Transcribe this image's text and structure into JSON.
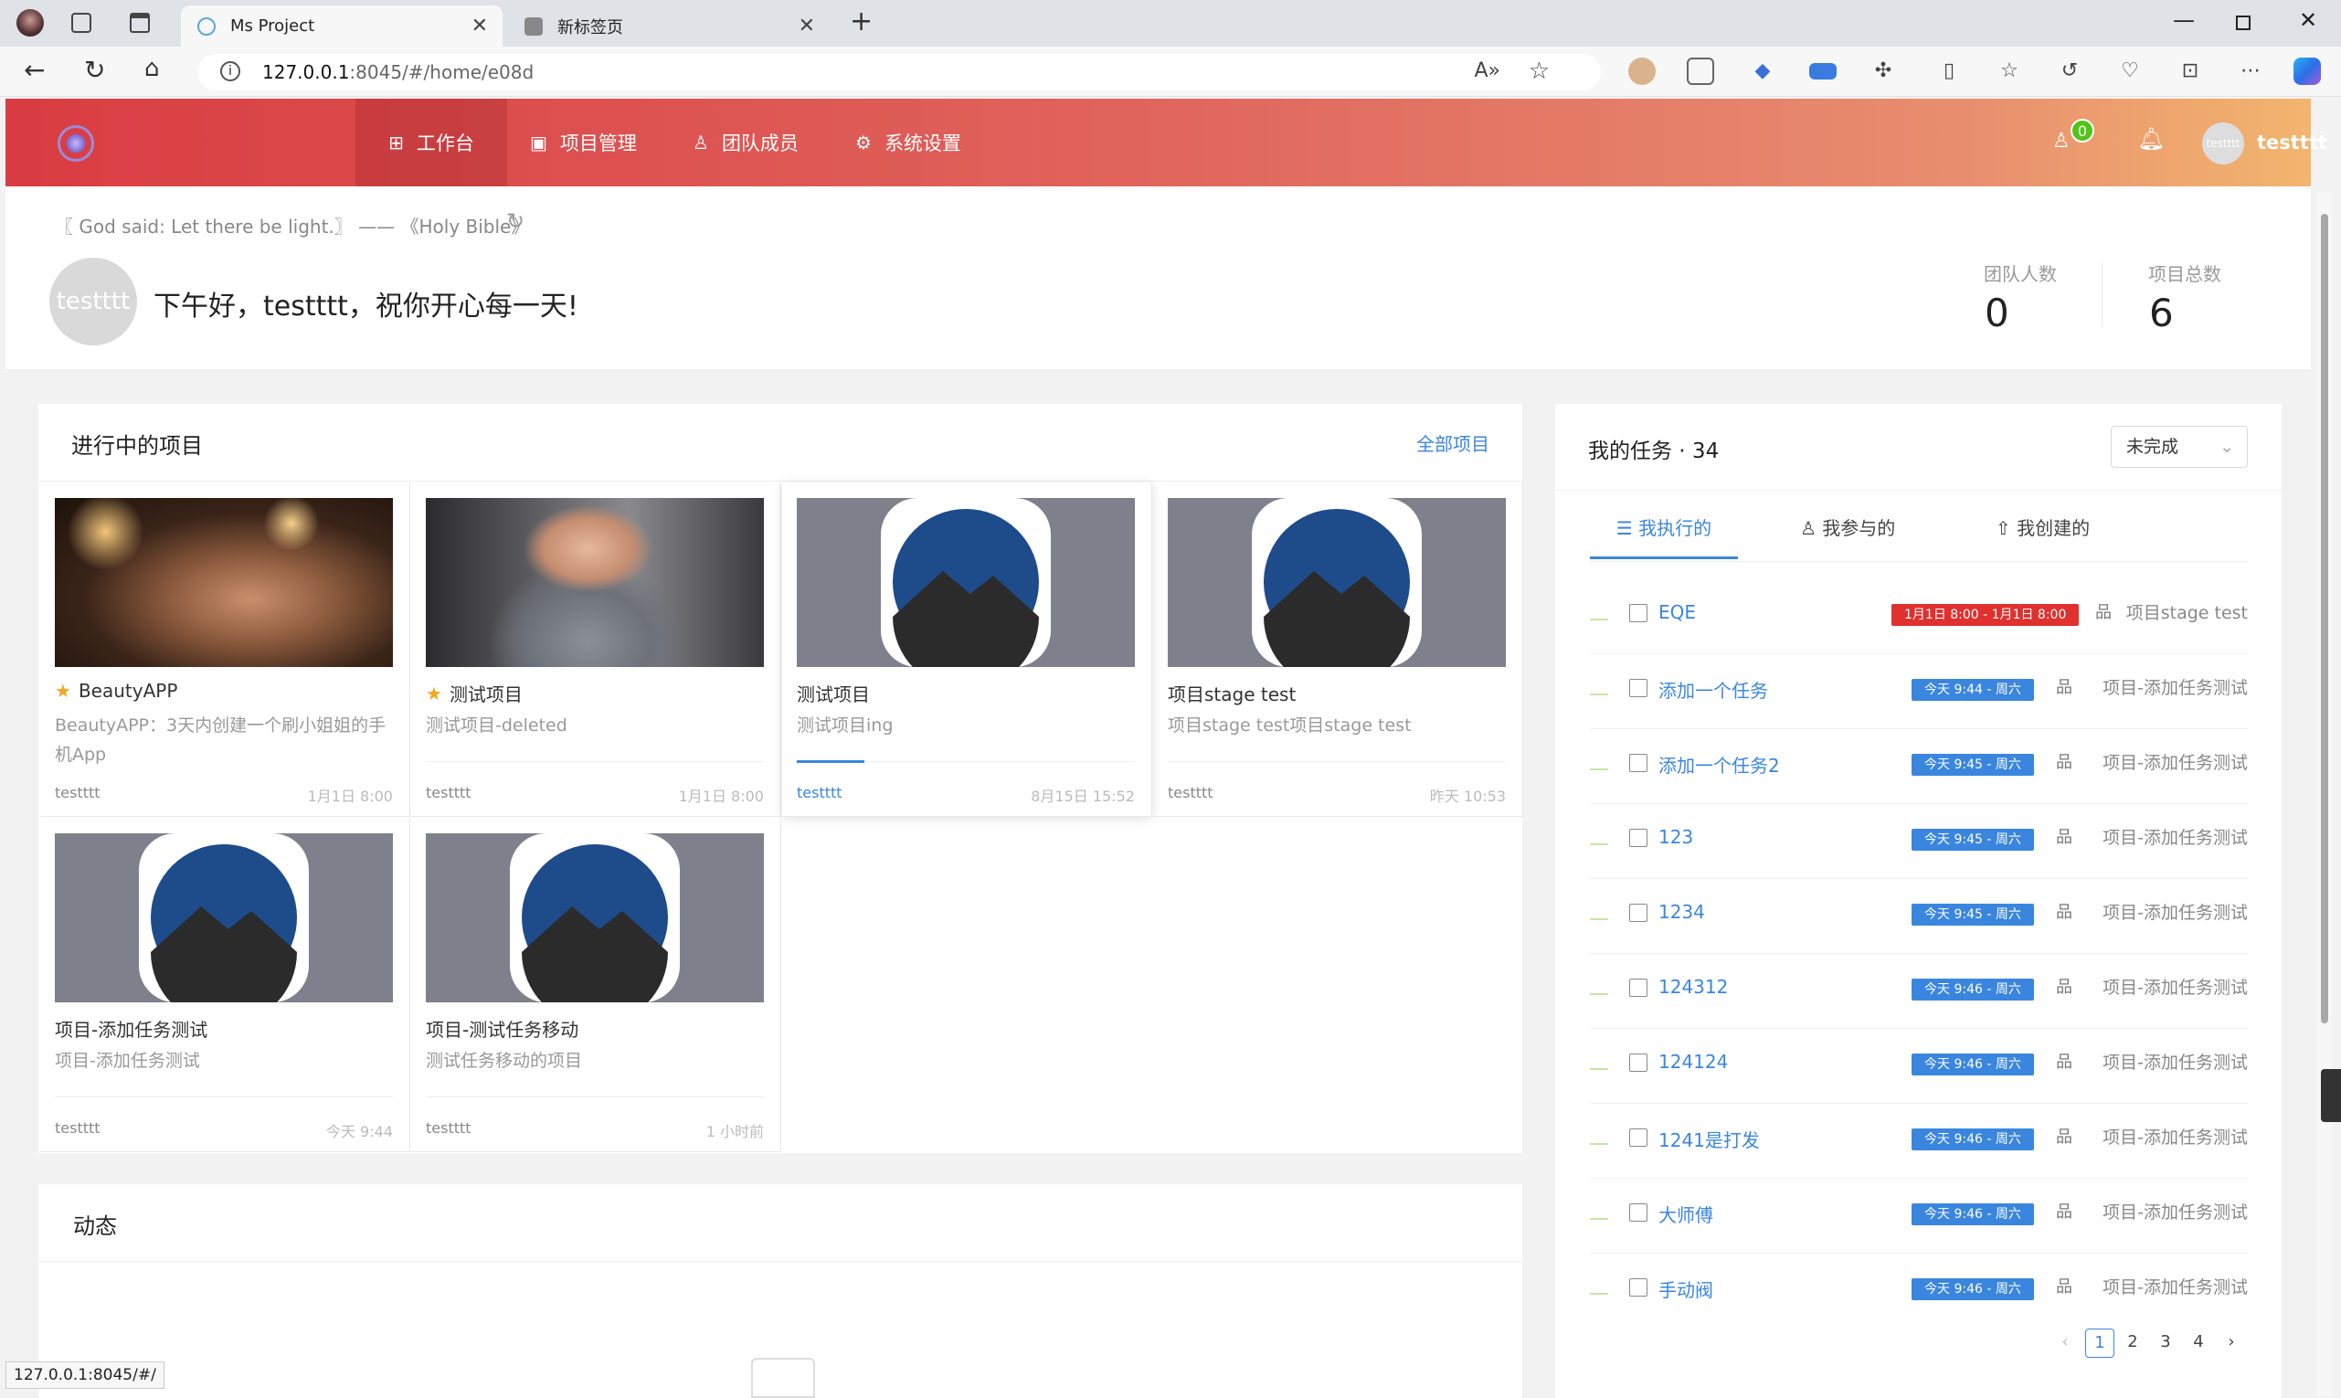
{
  "browser": {
    "tabs": [
      {
        "title": "Ms Project",
        "active": true
      },
      {
        "title": "新标签页",
        "active": false
      }
    ],
    "url_host": "127.0.0.1",
    "url_rest": ":8045/#/home/e08d",
    "status_url": "127.0.0.1:8045/#/"
  },
  "header": {
    "nav": [
      {
        "label": "工作台",
        "icon": "dashboard-icon",
        "active": true
      },
      {
        "label": "项目管理",
        "icon": "project-icon",
        "active": false
      },
      {
        "label": "团队成员",
        "icon": "team-icon",
        "active": false
      },
      {
        "label": "系统设置",
        "icon": "settings-icon",
        "active": false
      }
    ],
    "invite_count": "0",
    "user_name": "testttt",
    "avatar_text": "testttt"
  },
  "greeting": {
    "quote": "〖 God said: Let there be light.〗 —— 《Holy Bible》",
    "avatar_text": "testttt",
    "message": "下午好，testttt，祝你开心每一天!",
    "stats": [
      {
        "label": "团队人数",
        "value": "0"
      },
      {
        "label": "项目总数",
        "value": "6"
      }
    ]
  },
  "projects": {
    "title": "进行中的项目",
    "all_link": "全部项目",
    "items": [
      {
        "name": "BeautyAPP",
        "starred": true,
        "desc": "BeautyAPP：3天内创建一个刷小姐姐的手机App",
        "owner": "testttt",
        "time": "1月1日 8:00",
        "image": "woman-bar-photo"
      },
      {
        "name": "测试项目",
        "starred": true,
        "desc": "测试项目-deleted",
        "owner": "testttt",
        "time": "1月1日 8:00",
        "image": "woman-gym-photo"
      },
      {
        "name": "测试项目",
        "starred": false,
        "desc": "测试项目ing",
        "owner": "testttt",
        "time": "8月15日 15:52",
        "image": "default-project-icon",
        "progress": 0.2
      },
      {
        "name": "项目stage test",
        "starred": false,
        "desc": "项目stage test项目stage test",
        "owner": "testttt",
        "time": "昨天 10:53",
        "image": "default-project-icon"
      },
      {
        "name": "项目-添加任务测试",
        "starred": false,
        "desc": "项目-添加任务测试",
        "owner": "testttt",
        "time": "今天 9:44",
        "image": "default-project-icon"
      },
      {
        "name": "项目-测试任务移动",
        "starred": false,
        "desc": "测试任务移动的项目",
        "owner": "testttt",
        "time": "1 小时前",
        "image": "default-project-icon"
      }
    ]
  },
  "activity": {
    "title": "动态"
  },
  "tasks": {
    "title": "我的任务 · 34",
    "filter": "未完成",
    "tabs": [
      {
        "label": "我执行的",
        "icon": "list-icon",
        "active": true
      },
      {
        "label": "我参与的",
        "icon": "user-icon",
        "active": false
      },
      {
        "label": "我创建的",
        "icon": "rocket-icon",
        "active": false
      }
    ],
    "items": [
      {
        "name": "EQE",
        "due": "1月1日 8:00 - 1月1日 8:00",
        "overdue": true,
        "project": "项目stage test"
      },
      {
        "name": "添加一个任务",
        "due": "今天 9:44 - 周六",
        "overdue": false,
        "project": "项目-添加任务测试"
      },
      {
        "name": "添加一个任务2",
        "due": "今天 9:45 - 周六",
        "overdue": false,
        "project": "项目-添加任务测试"
      },
      {
        "name": "123",
        "due": "今天 9:45 - 周六",
        "overdue": false,
        "project": "项目-添加任务测试"
      },
      {
        "name": "1234",
        "due": "今天 9:45 - 周六",
        "overdue": false,
        "project": "项目-添加任务测试"
      },
      {
        "name": "124312",
        "due": "今天 9:46 - 周六",
        "overdue": false,
        "project": "项目-添加任务测试"
      },
      {
        "name": "124124",
        "due": "今天 9:46 - 周六",
        "overdue": false,
        "project": "项目-添加任务测试"
      },
      {
        "name": "1241是打发",
        "due": "今天 9:46 - 周六",
        "overdue": false,
        "project": "项目-添加任务测试"
      },
      {
        "name": "大师傅",
        "due": "今天 9:46 - 周六",
        "overdue": false,
        "project": "项目-添加任务测试"
      },
      {
        "name": "手动阀",
        "due": "今天 9:46 - 周六",
        "overdue": false,
        "project": "项目-添加任务测试"
      }
    ],
    "pagination": {
      "pages": [
        "1",
        "2",
        "3",
        "4"
      ],
      "current": "1",
      "prev": "‹",
      "next": "›"
    }
  },
  "colors": {
    "accent": "#3a86df",
    "header_start": "#d93c42",
    "header_end": "#f2b56e",
    "overdue": "#e0312f",
    "due": "#3a86df"
  }
}
